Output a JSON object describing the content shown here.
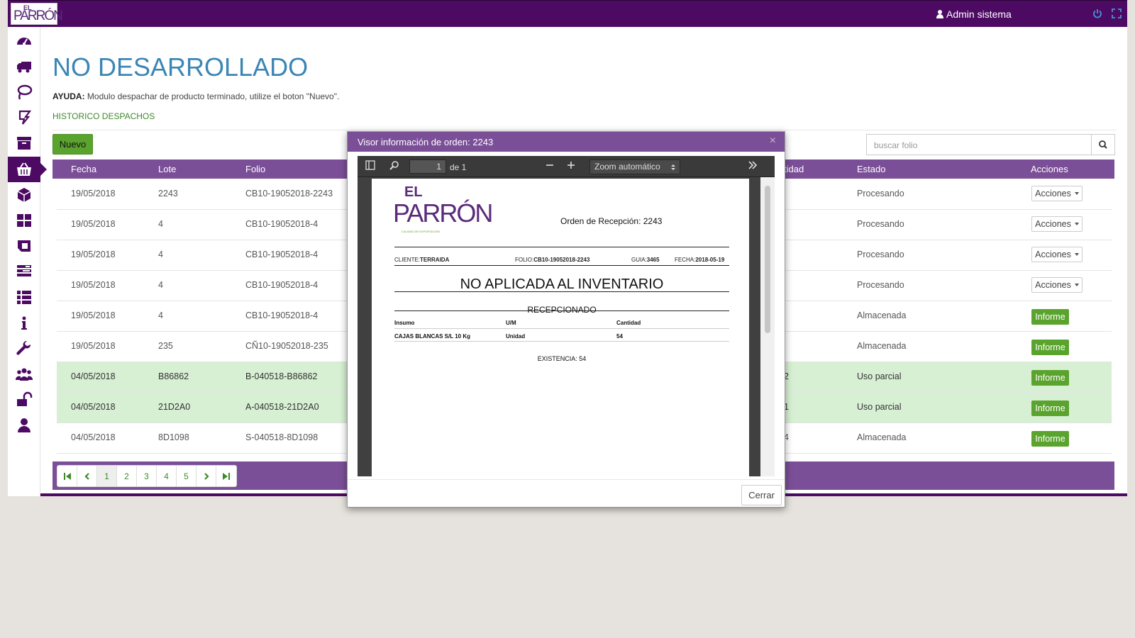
{
  "header": {
    "logo_top": "EL",
    "logo_main": "PARRÓN",
    "user_label": "Admin sistema"
  },
  "page": {
    "title": "NO DESARROLLADO",
    "help_label": "AYUDA:",
    "help_text": "Modulo despachar de producto terminado, utilize el boton \"Nuevo\".",
    "history_link": "HISTORICO DESPACHOS",
    "new_button": "Nuevo",
    "search_placeholder": "buscar folio"
  },
  "table": {
    "headers": {
      "fecha": "Fecha",
      "lote": "Lote",
      "folio": "Folio",
      "cantidad": "tidad",
      "estado": "Estado",
      "acciones": "Acciones"
    },
    "rows": [
      {
        "fecha": "19/05/2018",
        "lote": "2243",
        "folio": "CB10-19052018-2243",
        "cant": "",
        "estado": "Procesando",
        "action": "Acciones",
        "green": false
      },
      {
        "fecha": "19/05/2018",
        "lote": "4",
        "folio": "CB10-19052018-4",
        "cant": "",
        "estado": "Procesando",
        "action": "Acciones",
        "green": false
      },
      {
        "fecha": "19/05/2018",
        "lote": "4",
        "folio": "CB10-19052018-4",
        "cant": "",
        "estado": "Procesando",
        "action": "Acciones",
        "green": false
      },
      {
        "fecha": "19/05/2018",
        "lote": "4",
        "folio": "CB10-19052018-4",
        "cant": "",
        "estado": "Procesando",
        "action": "Acciones",
        "green": false
      },
      {
        "fecha": "19/05/2018",
        "lote": "4",
        "folio": "CB10-19052018-4",
        "cant": "",
        "estado": "Almacenada",
        "action": "Informe",
        "green": false
      },
      {
        "fecha": "19/05/2018",
        "lote": "235",
        "folio": "CÑ10-19052018-235",
        "cant": "",
        "estado": "Almacenada",
        "action": "Informe",
        "green": false
      },
      {
        "fecha": "04/05/2018",
        "lote": "B86862",
        "folio": "B-040518-B86862",
        "cant": "2",
        "estado": "Uso parcial",
        "action": "Informe",
        "green": true
      },
      {
        "fecha": "04/05/2018",
        "lote": "21D2A0",
        "folio": "A-040518-21D2A0",
        "cant": "1",
        "estado": "Uso parcial",
        "action": "Informe",
        "green": true
      },
      {
        "fecha": "04/05/2018",
        "lote": "8D1098",
        "folio": "S-040518-8D1098",
        "cant": "4",
        "estado": "Almacenada",
        "action": "Informe",
        "green": false
      }
    ]
  },
  "pagination": {
    "pages": [
      "1",
      "2",
      "3",
      "4",
      "5"
    ],
    "current": "1"
  },
  "modal": {
    "title": "Visor información de orden: 2243",
    "close_x": "×",
    "close_button": "Cerrar",
    "viewer": {
      "page_value": "1",
      "page_of": "de 1",
      "zoom": "Zoom automático"
    },
    "doc": {
      "logo_top": "EL",
      "logo_main": "PARRÓN",
      "logo_sub": "CALIDAD DE EXPORTACION",
      "orden": "Orden de Recepción: 2243",
      "cliente_label": "CLIENTE:",
      "cliente": "TERRAIDA",
      "folio_label": "FOLIO:",
      "folio": "CB10-19052018-2243",
      "guia_label": "GUIA:",
      "guia": "3465",
      "fecha_label": "FECHA:",
      "fecha": "2018-05-19",
      "status": "NO APLICADA AL INVENTARIO",
      "recepcionado": "RECEPCIONADO",
      "col_insumo": "Insumo",
      "col_um": "U/M",
      "col_cantidad": "Cantidad",
      "row_insumo": "CAJAS BLANCAS S/L 10 Kg",
      "row_um": "Unidad",
      "row_cantidad": "54",
      "existencia": "EXISTENCIA: 54"
    }
  },
  "icons": [
    "dashboard-icon",
    "truck-icon",
    "lasso-icon",
    "form-icon",
    "archive-icon",
    "basket-icon",
    "cube-icon",
    "grid-icon",
    "panel-icon",
    "tasks-icon",
    "list-icon",
    "info-icon",
    "wrench-icon",
    "users-icon",
    "unlock-icon",
    "user-icon"
  ],
  "colors": {
    "brand": "#4d0a63",
    "header_purple": "#7b4f98",
    "accent_green": "#5aa42e",
    "title_blue": "#3a86b5",
    "row_highlight": "#d7f0d3"
  }
}
